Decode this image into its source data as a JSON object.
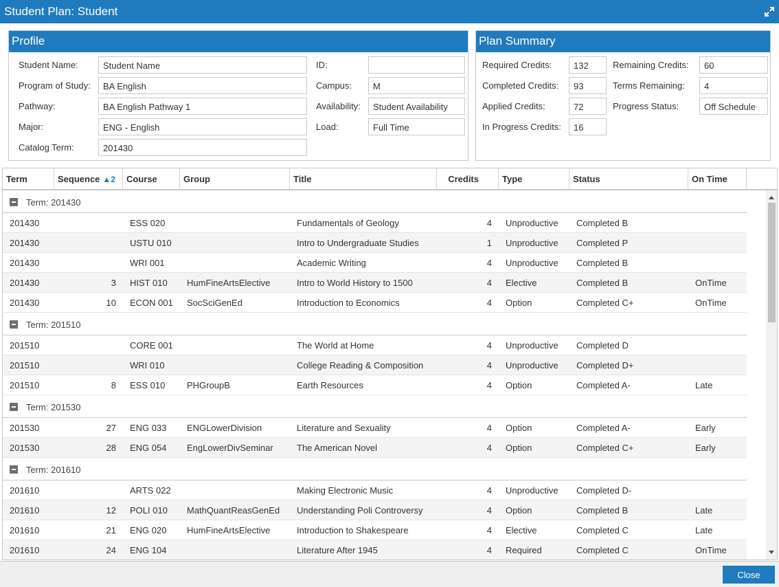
{
  "window": {
    "title": "Student Plan:  Student"
  },
  "profile": {
    "header": "Profile",
    "student_name": {
      "label": "Student Name:",
      "value": "Student Name"
    },
    "program": {
      "label": "Program of Study:",
      "value": "BA English"
    },
    "pathway": {
      "label": "Pathway:",
      "value": "BA English Pathway 1"
    },
    "major": {
      "label": "Major:",
      "value": "ENG - English"
    },
    "catalog": {
      "label": "Catalog Term:",
      "value": "201430"
    },
    "id": {
      "label": "ID:",
      "value": ""
    },
    "campus": {
      "label": "Campus:",
      "value": "M"
    },
    "availability": {
      "label": "Availability:",
      "value": "Student Availability"
    },
    "load": {
      "label": "Load:",
      "value": "Full Time"
    }
  },
  "summary": {
    "header": "Plan Summary",
    "required": {
      "label": "Required Credits:",
      "value": "132"
    },
    "completed": {
      "label": "Completed Credits:",
      "value": "93"
    },
    "applied": {
      "label": "Applied Credits:",
      "value": "72"
    },
    "in_progress": {
      "label": "In Progress Credits:",
      "value": "16"
    },
    "remaining": {
      "label": "Remaining Credits:",
      "value": "60"
    },
    "terms_remaining": {
      "label": "Terms Remaining:",
      "value": "4"
    },
    "progress_status": {
      "label": "Progress Status:",
      "value": "Off Schedule"
    }
  },
  "grid": {
    "columns": {
      "term": "Term",
      "sequence": "Sequence",
      "sequence_sort": "2",
      "course": "Course",
      "group": "Group",
      "title": "Title",
      "credits": "Credits",
      "type": "Type",
      "status": "Status",
      "ontime": "On Time"
    },
    "groups": [
      {
        "label": "Term: 201430",
        "rows": [
          [
            "201430",
            "",
            "ESS 020",
            "",
            "Fundamentals of Geology",
            "4",
            "Unproductive",
            "Completed B",
            ""
          ],
          [
            "201430",
            "",
            "USTU 010",
            "",
            "Intro to Undergraduate Studies",
            "1",
            "Unproductive",
            "Completed P",
            ""
          ],
          [
            "201430",
            "",
            "WRI 001",
            "",
            "Academic Writing",
            "4",
            "Unproductive",
            "Completed B",
            ""
          ],
          [
            "201430",
            "3",
            "HIST 010",
            "HumFineArtsElective",
            "Intro to World History to 1500",
            "4",
            "Elective",
            "Completed B",
            "OnTime"
          ],
          [
            "201430",
            "10",
            "ECON 001",
            "SocSciGenEd",
            "Introduction to Economics",
            "4",
            "Option",
            "Completed C+",
            "OnTime"
          ]
        ]
      },
      {
        "label": "Term: 201510",
        "rows": [
          [
            "201510",
            "",
            "CORE 001",
            "",
            "The World at Home",
            "4",
            "Unproductive",
            "Completed D",
            ""
          ],
          [
            "201510",
            "",
            "WRI 010",
            "",
            "College Reading & Composition",
            "4",
            "Unproductive",
            "Completed D+",
            ""
          ],
          [
            "201510",
            "8",
            "ESS 010",
            "PHGroupB",
            "Earth Resources",
            "4",
            "Option",
            "Completed A-",
            "Late"
          ]
        ]
      },
      {
        "label": "Term: 201530",
        "rows": [
          [
            "201530",
            "27",
            "ENG 033",
            "ENGLowerDivision",
            "Literature and Sexuality",
            "4",
            "Option",
            "Completed A-",
            "Early"
          ],
          [
            "201530",
            "28",
            "ENG 054",
            "EngLowerDivSeminar",
            "The American Novel",
            "4",
            "Option",
            "Completed C+",
            "Early"
          ]
        ]
      },
      {
        "label": "Term: 201610",
        "rows": [
          [
            "201610",
            "",
            "ARTS 022",
            "",
            "Making Electronic Music",
            "4",
            "Unproductive",
            "Completed D-",
            ""
          ],
          [
            "201610",
            "12",
            "POLI 010",
            "MathQuantReasGenEd",
            "Understanding Poli Controversy",
            "4",
            "Option",
            "Completed B",
            "Late"
          ],
          [
            "201610",
            "21",
            "ENG 020",
            "HumFineArtsElective",
            "Introduction to Shakespeare",
            "4",
            "Elective",
            "Completed C",
            "Late"
          ],
          [
            "201610",
            "24",
            "ENG 104",
            "",
            "Literature After 1945",
            "4",
            "Required",
            "Completed C",
            "OnTime"
          ]
        ]
      }
    ]
  },
  "footer": {
    "close_label": "Close"
  }
}
